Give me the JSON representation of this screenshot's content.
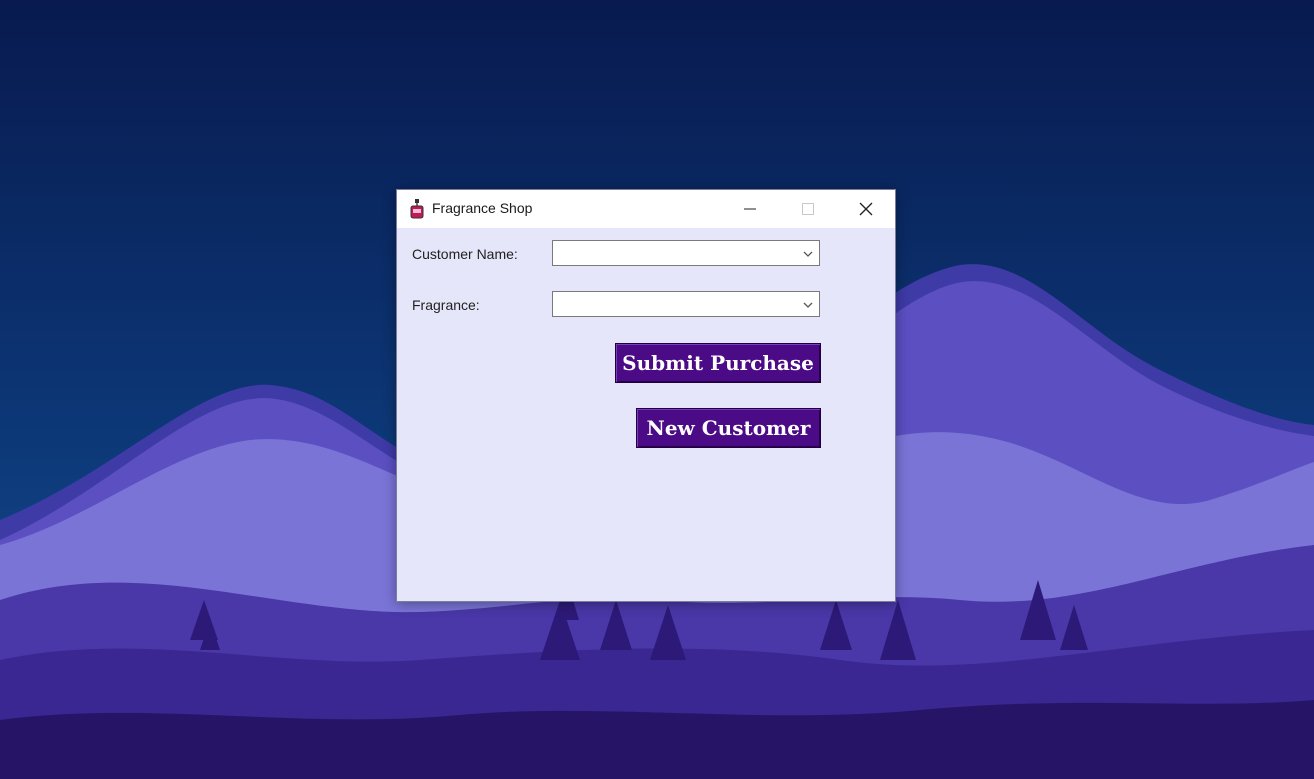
{
  "window": {
    "title": "Fragrance Shop",
    "app_icon": "perfume-bottle-icon",
    "controls": [
      "minimize-icon",
      "maximize-icon",
      "close-icon"
    ]
  },
  "form": {
    "customer_name_label": "Customer Name:",
    "customer_name_value": "",
    "fragrance_label": "Fragrance:",
    "fragrance_value": ""
  },
  "buttons": {
    "submit_label": "Submit Purchase",
    "new_customer_label": "New Customer"
  },
  "colors": {
    "button_bg": "#4b0a86",
    "window_bg": "#e6e6fa",
    "desktop_sky": "#0b1a52",
    "mountains": "#6a55c8"
  }
}
